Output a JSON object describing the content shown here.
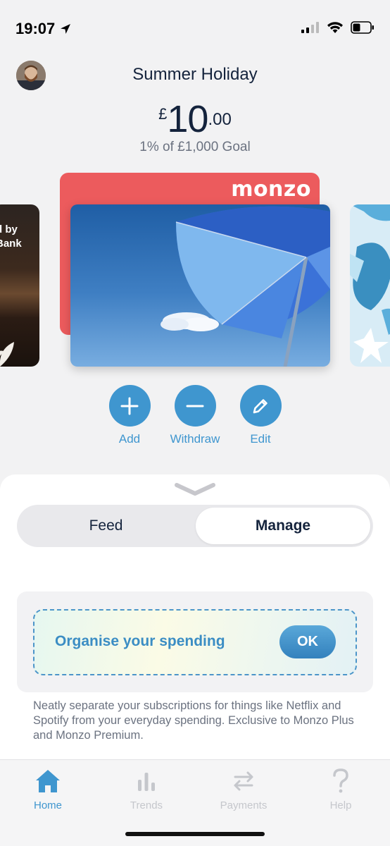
{
  "status": {
    "time": "19:07"
  },
  "pot": {
    "title": "Summer Holiday",
    "currency": "£",
    "amount_main": "10",
    "amount_decimal": ".00",
    "goal_text": "1% of £1,000 Goal"
  },
  "cards": {
    "brand": "monzo",
    "left_card_text_line1": "d by",
    "left_card_text_line2": "Bank"
  },
  "actions": [
    {
      "label": "Add",
      "icon": "plus-icon"
    },
    {
      "label": "Withdraw",
      "icon": "minus-icon"
    },
    {
      "label": "Edit",
      "icon": "pencil-icon"
    }
  ],
  "segmented": {
    "feed": "Feed",
    "manage": "Manage",
    "selected": "Manage"
  },
  "promo": {
    "title": "Organise your spending",
    "ok_label": "OK",
    "description": "Neatly separate your subscriptions for things like Netflix and Spotify from your everyday spending. Exclusive to Monzo Plus and Monzo Premium."
  },
  "tabbar": [
    {
      "label": "Home",
      "icon": "home-icon",
      "active": true
    },
    {
      "label": "Trends",
      "icon": "bar-chart-icon",
      "active": false
    },
    {
      "label": "Payments",
      "icon": "transfer-arrows-icon",
      "active": false
    },
    {
      "label": "Help",
      "icon": "question-mark-icon",
      "active": false
    }
  ],
  "colors": {
    "accent": "#3f96cf",
    "card_red": "#ec5b5d",
    "text_dark": "#14233c"
  }
}
